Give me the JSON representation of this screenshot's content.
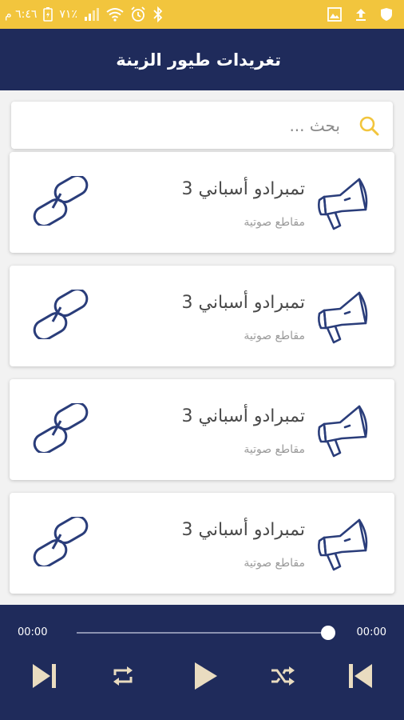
{
  "status_bar": {
    "time": "٦:٤٦ م",
    "battery": "٧١٪"
  },
  "app_bar": {
    "title": "تغريدات طيور الزينة"
  },
  "search": {
    "placeholder": "بحث ..."
  },
  "items": [
    {
      "title": "تمبرادو أسباني 3",
      "subtitle": "مقاطع صوتية"
    },
    {
      "title": "تمبرادو أسباني 3",
      "subtitle": "مقاطع صوتية"
    },
    {
      "title": "تمبرادو أسباني 3",
      "subtitle": "مقاطع صوتية"
    },
    {
      "title": "تمبرادو أسباني 3",
      "subtitle": "مقاطع صوتية"
    }
  ],
  "player": {
    "elapsed": "00:00",
    "duration": "00:00",
    "progress": 1.0
  },
  "colors": {
    "status_bar": "#f2c53d",
    "primary": "#1f2b5b",
    "accent": "#f2c53d",
    "icon_line": "#2a3d7a",
    "controls": "#e9dcc0"
  }
}
